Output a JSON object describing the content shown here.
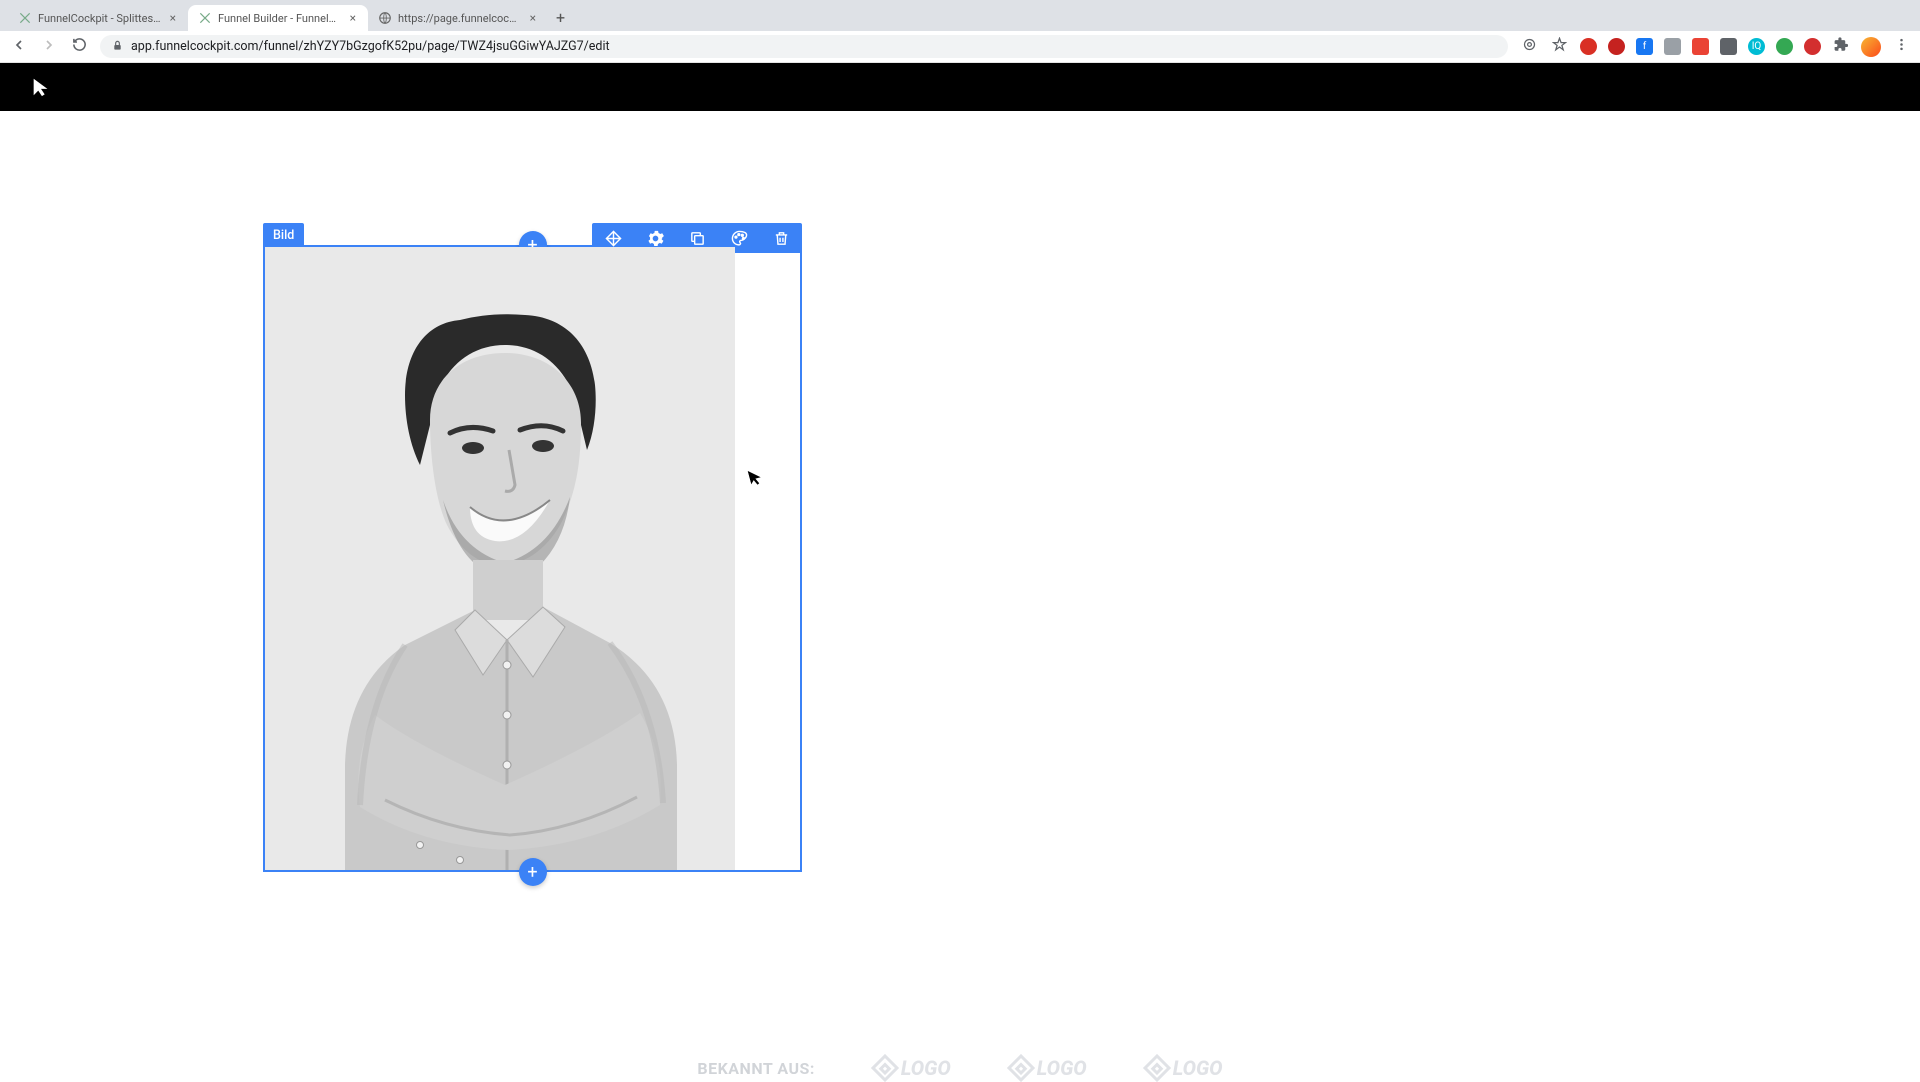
{
  "browser": {
    "tabs": [
      {
        "title": "FunnelCockpit - Splittests, Ma",
        "active": false
      },
      {
        "title": "Funnel Builder - FunnelCockpit",
        "active": true
      },
      {
        "title": "https://page.funnelcockpit.co",
        "active": false
      }
    ],
    "url": "app.funnelcockpit.com/funnel/zhYZY7bGzgofK52pu/page/TWZ4jsuGGiwYAJZG7/edit",
    "new_tab": "+",
    "back": "←",
    "fwd": "→",
    "reload": "⟳"
  },
  "editor": {
    "element_label": "Bild",
    "add": "+",
    "toolbar": {
      "move": "move-icon",
      "settings": "gear-icon",
      "copy": "copy-icon",
      "style": "palette-icon",
      "delete": "trash-icon"
    }
  },
  "footer": {
    "known_from": "BEKANNT AUS:",
    "logo_text": "LOGO"
  }
}
